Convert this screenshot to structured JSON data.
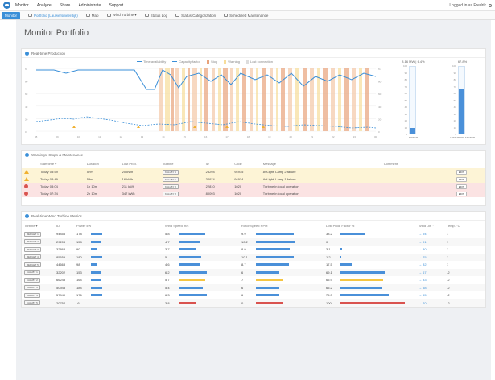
{
  "topbar": {
    "nav": [
      "Monitor",
      "Analyze",
      "Share",
      "Administrate",
      "Support"
    ],
    "user": "Logged in as Fredrik"
  },
  "subbar": {
    "tabs": [
      {
        "label": "Monitor",
        "active": true
      },
      {
        "label": "Portfolio (Lauwersmeerdijk)",
        "sel": true
      },
      {
        "label": "Map"
      },
      {
        "label": "Wind Turbine ▾"
      },
      {
        "label": "Status Log"
      },
      {
        "label": "Status Categorization"
      },
      {
        "label": "Scheduled Maintenance"
      }
    ]
  },
  "page_title": "Monitor Portfolio",
  "production": {
    "title": "Real-time Production",
    "legend": [
      "Time availability",
      "Capacity factor",
      "Stop",
      "Warning",
      "Lost connection"
    ],
    "power_value": "8.16 MW",
    "power_sep": "|",
    "power_pct": "6.4%",
    "lpf_value": "67.8%",
    "power_label": "POWER",
    "lpf_label": "LOST PROD. FACTOR",
    "y_left": [
      "%",
      "80",
      "60",
      "40",
      "20",
      "0"
    ],
    "y_right": [
      "%",
      "80",
      "60",
      "40",
      "20",
      "0"
    ],
    "x_ticks": [
      "08",
      "09",
      "10",
      "11",
      "12",
      "13",
      "14",
      "15",
      "16",
      "17",
      "18",
      "19",
      "20",
      "21",
      "22",
      "23",
      "00"
    ],
    "right_axis": [
      "100",
      "90",
      "80",
      "70",
      "60",
      "50",
      "40",
      "30",
      "20",
      "10",
      "0"
    ],
    "power_fill": 0.08,
    "lpf_fill": 0.68
  },
  "warnings": {
    "title": "Warnings, Stops & Maintenance",
    "columns": [
      "Start time ▾",
      "Duration",
      "Lost Prod.",
      "Turbine",
      "ID",
      "Code",
      "Message",
      "Comment"
    ],
    "rows": [
      {
        "type": "warn",
        "start": "Today 08:59",
        "duration": "57m",
        "lost": "20 kWh",
        "turbine": "KALLBY 4",
        "id": "25294",
        "code": "94915",
        "message": "AvLight, Lamp 2 failure",
        "btn": "EDIT"
      },
      {
        "type": "warn",
        "start": "Today 08:49",
        "duration": "59m",
        "lost": "16 kWh",
        "turbine": "KALLBY 6",
        "id": "34974",
        "code": "94914",
        "message": "AvLight, Lamp 1 failure",
        "btn": "EDIT"
      },
      {
        "type": "err",
        "start": "Today 08:04",
        "duration": "1h 10m",
        "lost": "211 kWh",
        "turbine": "KALLBY 8",
        "id": "22810",
        "code": "1020",
        "message": "Turbine in local operation",
        "btn": "EDIT"
      },
      {
        "type": "err",
        "start": "Today 07:34",
        "duration": "2h 10m",
        "lost": "347 kWh",
        "turbine": "KALLBY 8",
        "id": "80093",
        "code": "1020",
        "message": "Turbine in local operation",
        "btn": "EDIT"
      }
    ]
  },
  "metrics": {
    "title": "Real-time Wind Turbine Metrics",
    "columns": [
      "Turbine ▾",
      "ID",
      "Power kW",
      "Wind Speed m/s",
      "Rotor Speed RPM",
      "Lost Prod. Factor %",
      "Wind Dir. °",
      "Temp. °C"
    ],
    "rows": [
      {
        "turbine": "BERGET 1",
        "id": "94455",
        "power": "178",
        "pw": 0.17,
        "wind": "5.8",
        "ws": 0.45,
        "rotor": "9.9",
        "rs": 0.62,
        "lpf": "38.2",
        "lp": 0.38,
        "dir": "→ 94",
        "temp": "1"
      },
      {
        "turbine": "BERGET 2",
        "id": "29203",
        "power": "158",
        "pw": 0.15,
        "wind": "4.7",
        "ws": 0.37,
        "rotor": "10.2",
        "rs": 0.64,
        "lpf": "0",
        "lp": 0.0,
        "dir": "→ 91",
        "temp": "1"
      },
      {
        "turbine": "BERGET 3",
        "id": "32863",
        "power": "90",
        "pw": 0.09,
        "wind": "3.7",
        "ws": 0.29,
        "rotor": "8.9",
        "rs": 0.56,
        "lpf": "3.1",
        "lp": 0.03,
        "dir": "→ 80",
        "temp": "1"
      },
      {
        "turbine": "BERGET 4",
        "id": "85659",
        "power": "180",
        "pw": 0.17,
        "wind": "5",
        "ws": 0.39,
        "rotor": "10.1",
        "rs": 0.63,
        "lpf": "1.2",
        "lp": 0.01,
        "dir": "→ 75",
        "temp": "1"
      },
      {
        "turbine": "BERGET 5",
        "id": "44663",
        "power": "98",
        "pw": 0.09,
        "wind": "4.6",
        "ws": 0.36,
        "rotor": "8.7",
        "rs": 0.55,
        "lpf": "17.5",
        "lp": 0.17,
        "dir": "→ 82",
        "temp": "1"
      },
      {
        "turbine": "KALLBY 1",
        "id": "32202",
        "power": "153",
        "pw": 0.15,
        "wind": "6.2",
        "ws": 0.48,
        "rotor": "6",
        "rs": 0.38,
        "lpf": "69.1",
        "lp": 0.69,
        "dir": "→ 67",
        "temp": "-2"
      },
      {
        "turbine": "KALLBY 2",
        "id": "66243",
        "power": "164",
        "pw": 0.16,
        "wind": "5.7",
        "ws": 0.45,
        "bw": "y",
        "rotor": "7",
        "rs": 0.44,
        "rw": "y",
        "lpf": "65.9",
        "lp": 0.66,
        "lw": "y",
        "dir": "→ 33",
        "temp": "-2"
      },
      {
        "turbine": "KALLBY 3",
        "id": "50943",
        "power": "184",
        "pw": 0.18,
        "wind": "5.4",
        "ws": 0.42,
        "rotor": "6",
        "rs": 0.38,
        "lpf": "65.2",
        "lp": 0.65,
        "dir": "→ 58",
        "temp": "-2"
      },
      {
        "turbine": "KALLBY 4",
        "id": "57949",
        "power": "176",
        "pw": 0.17,
        "wind": "6.3",
        "ws": 0.49,
        "rotor": "6",
        "rs": 0.38,
        "lpf": "75.3",
        "lp": 0.75,
        "dir": "→ 65",
        "temp": "-2"
      },
      {
        "turbine": "KALLBY 5",
        "id": "20754",
        "power": "-61",
        "pw": 0.0,
        "wind": "3.8",
        "ws": 0.3,
        "bw": "r",
        "rotor": "0",
        "rs": 0.45,
        "rw": "r",
        "lpf": "100",
        "lp": 1.0,
        "lw": "r",
        "dir": "→ 70",
        "temp": "-2"
      }
    ]
  }
}
